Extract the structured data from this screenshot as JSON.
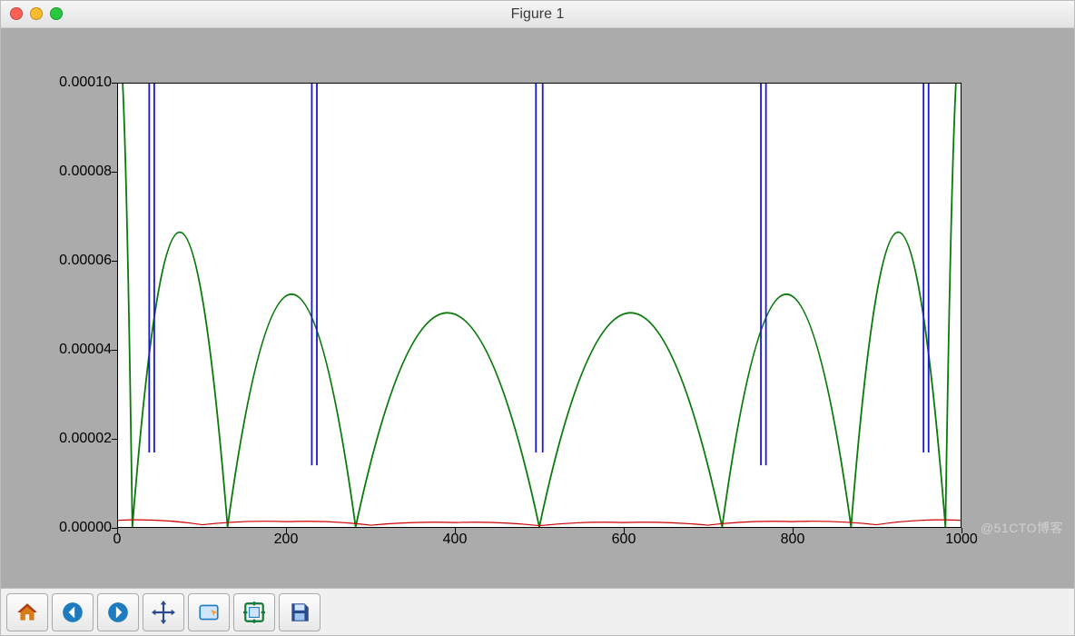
{
  "window": {
    "title": "Figure 1"
  },
  "watermark": "@51CTO博客",
  "toolbar": {
    "buttons": [
      {
        "name": "home",
        "tip": "Home"
      },
      {
        "name": "back",
        "tip": "Back"
      },
      {
        "name": "forward",
        "tip": "Forward"
      },
      {
        "name": "pan",
        "tip": "Pan"
      },
      {
        "name": "zoom",
        "tip": "Zoom"
      },
      {
        "name": "config",
        "tip": "Configure subplots"
      },
      {
        "name": "save",
        "tip": "Save"
      }
    ]
  },
  "chart_data": {
    "type": "line",
    "xlim": [
      0,
      1000
    ],
    "ylim": [
      0.0,
      0.0001
    ],
    "xticks": [
      0,
      200,
      400,
      600,
      800,
      1000
    ],
    "yticks": [
      0.0,
      2e-05,
      4e-05,
      6e-05,
      8e-05,
      0.0001
    ],
    "ytick_labels": [
      "0.00000",
      "0.00002",
      "0.00004",
      "0.00006",
      "0.00008",
      "0.00010"
    ],
    "title": "",
    "xlabel": "",
    "ylabel": "",
    "series": [
      {
        "name": "green",
        "color": "#0a7a0a",
        "note": "arch-like lobes touching zero at each root; peaks roughly at midpoints",
        "roots_x": [
          17,
          130,
          282,
          500,
          717,
          870,
          982
        ],
        "peaks": [
          {
            "x": 73,
            "y": 6.65e-05
          },
          {
            "x": 206,
            "y": 5.25e-05
          },
          {
            "x": 391,
            "y": 4.83e-05
          },
          {
            "x": 608,
            "y": 4.83e-05
          },
          {
            "x": 793,
            "y": 5.25e-05
          },
          {
            "x": 926,
            "y": 6.65e-05
          }
        ],
        "clip_entry_left": true,
        "clip_entry_right": true
      },
      {
        "name": "blue",
        "color": "#1818d8",
        "note": "narrow vertical spikes shooting above ylim; base around 1.4-1.7e-5",
        "spikes": [
          {
            "x": 40,
            "width": 6,
            "base": 1.68e-05
          },
          {
            "x": 233,
            "width": 6,
            "base": 1.39e-05
          },
          {
            "x": 500,
            "width": 8,
            "base": 1.68e-05
          },
          {
            "x": 766,
            "width": 6,
            "base": 1.39e-05
          },
          {
            "x": 959,
            "width": 6,
            "base": 1.68e-05
          }
        ]
      },
      {
        "name": "red",
        "color": "#cc0000",
        "note": "very low-amplitude ripple near baseline",
        "samples_x": [
          0,
          100,
          200,
          300,
          400,
          500,
          600,
          700,
          800,
          900,
          1000
        ],
        "samples_y": [
          1.5e-06,
          5e-07,
          1.2e-06,
          4e-07,
          1e-06,
          3e-07,
          1e-06,
          4e-07,
          1.2e-06,
          5e-07,
          1.5e-06
        ]
      }
    ]
  }
}
